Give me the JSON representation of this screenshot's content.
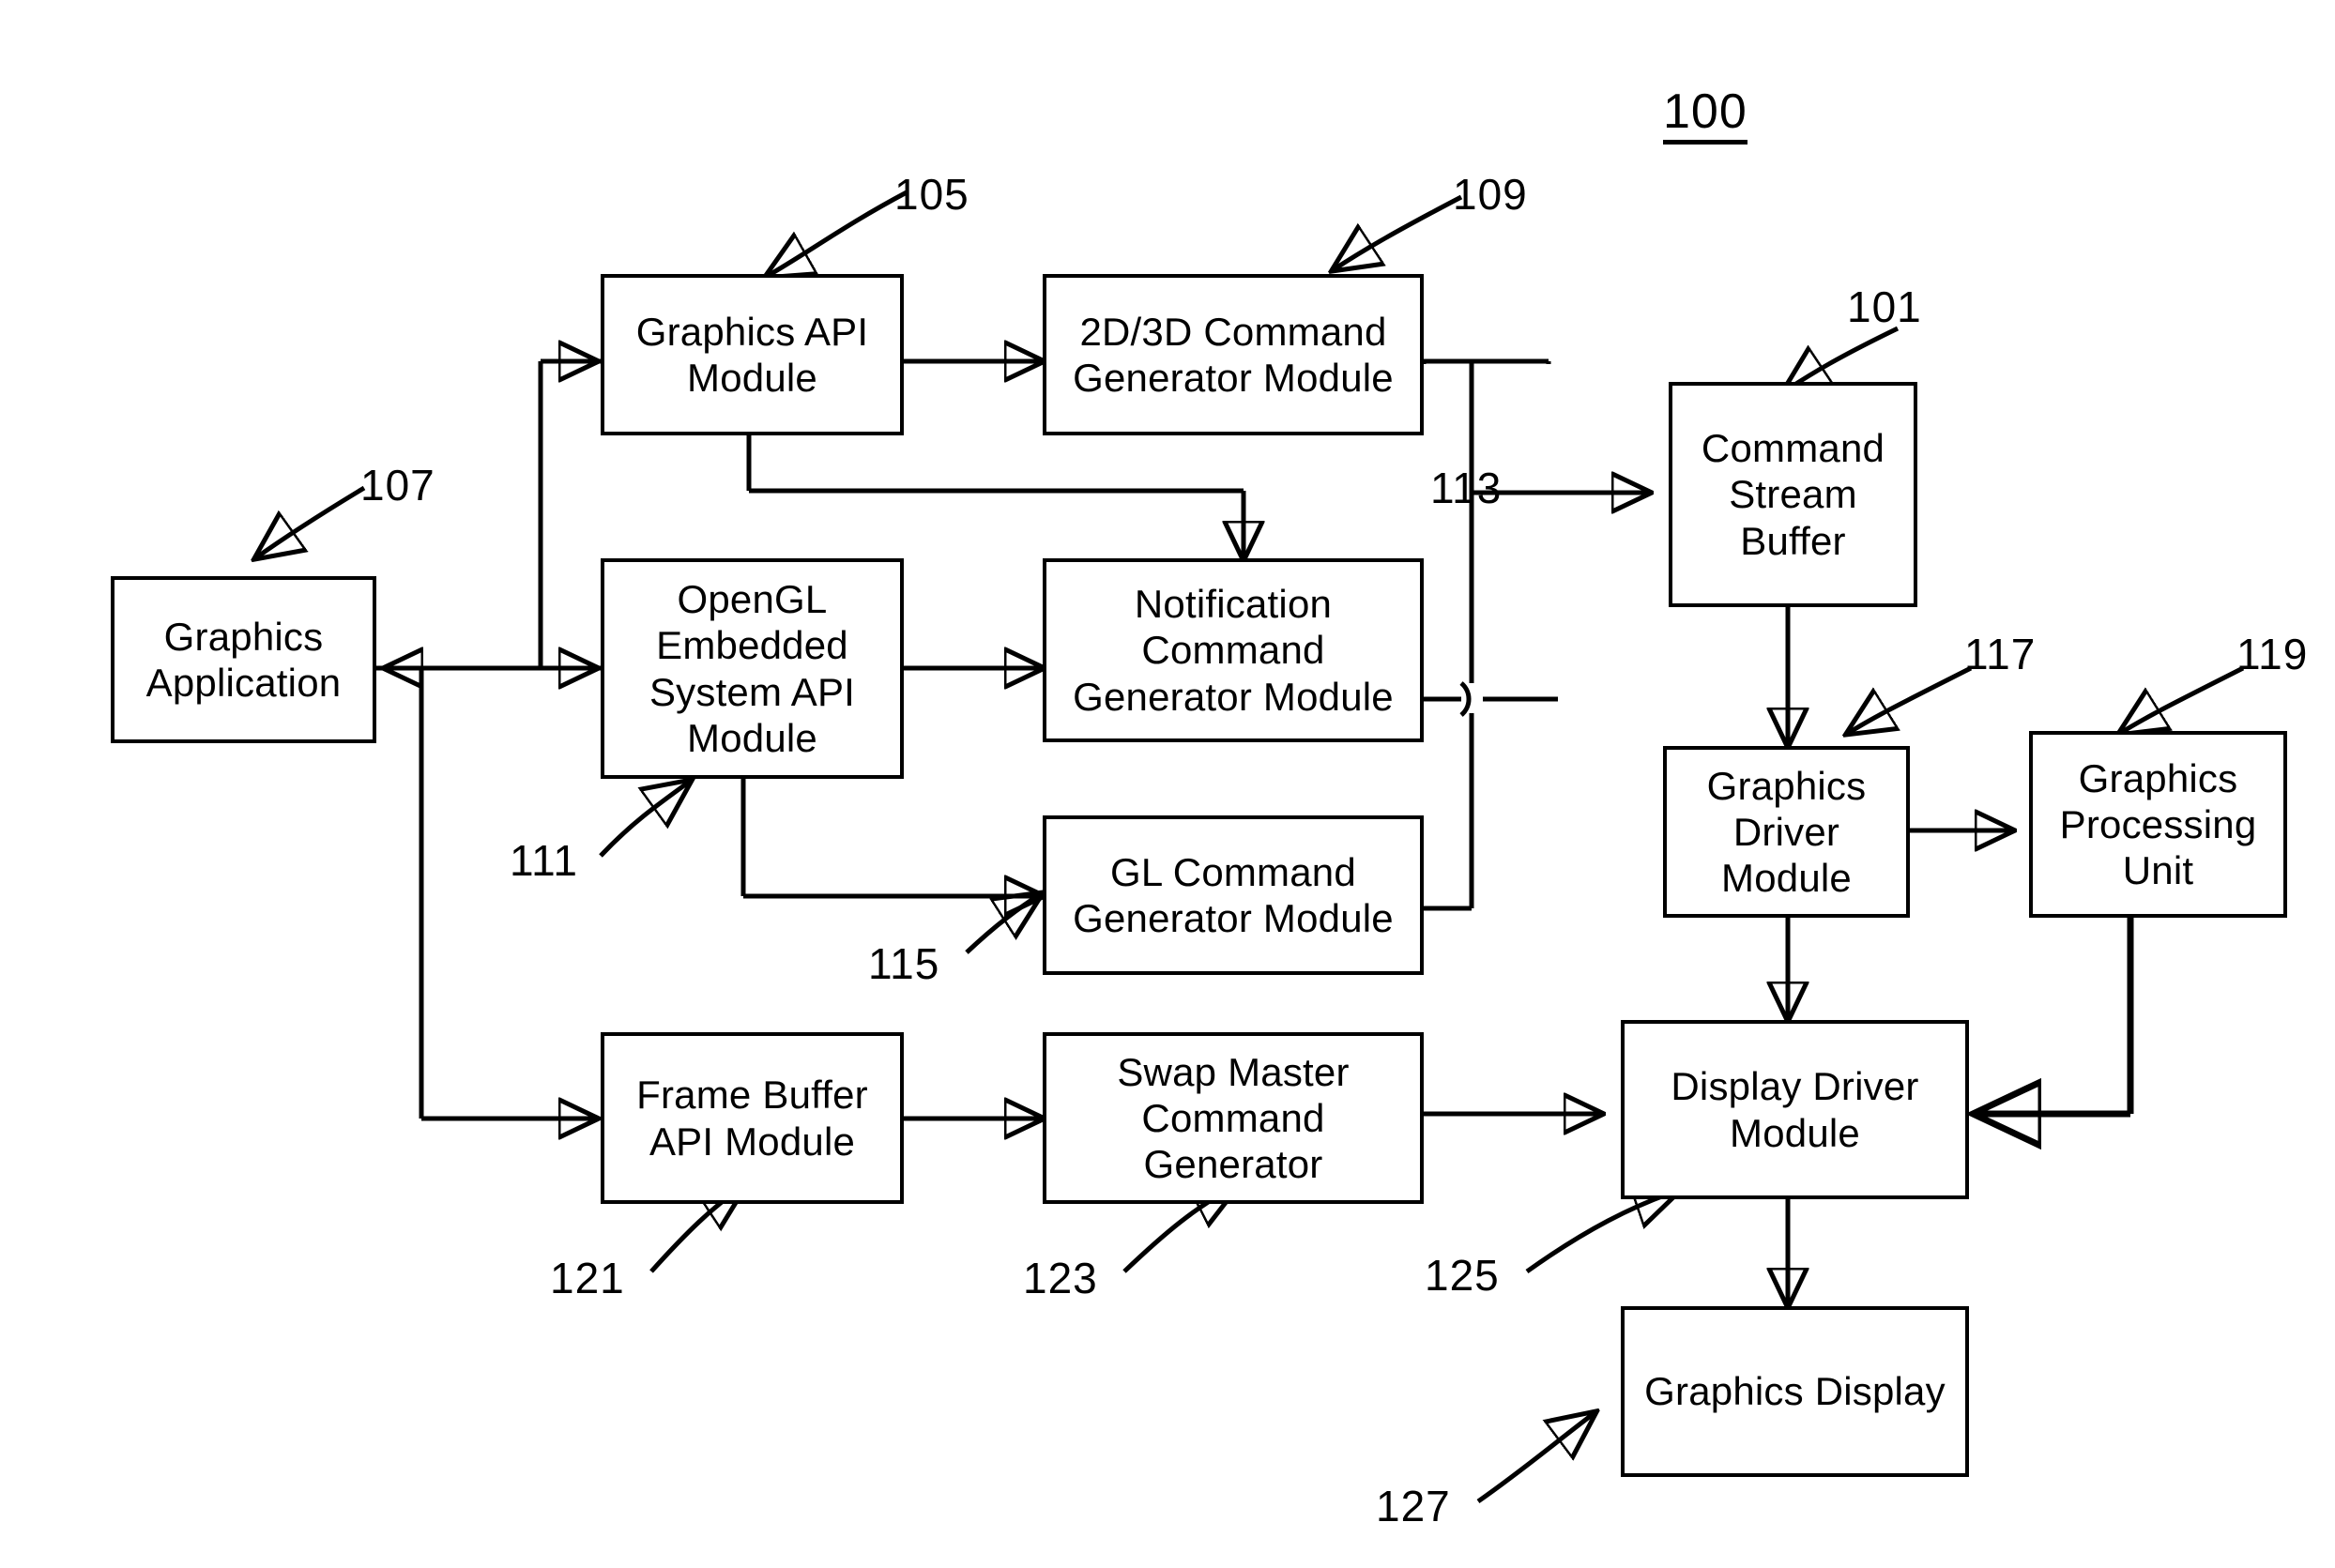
{
  "figure": {
    "number": "100",
    "type": "patent-block-diagram",
    "background": "#ffffff",
    "ink": "#000000"
  },
  "blocks": [
    {
      "id": "graphics_application",
      "label": "Graphics\nApplication",
      "ref": "107"
    },
    {
      "id": "graphics_api_module",
      "label": "Graphics API\nModule",
      "ref": "105"
    },
    {
      "id": "opengl_es_api_module",
      "label": "OpenGL\nEmbedded\nSystem API\nModule",
      "ref": "111"
    },
    {
      "id": "frame_buffer_api_module",
      "label": "Frame Buffer\nAPI Module",
      "ref": "121"
    },
    {
      "id": "cmd_gen_2d3d",
      "label": "2D/3D Command\nGenerator Module",
      "ref": "109"
    },
    {
      "id": "notification_cmd_gen",
      "label": "Notification\nCommand\nGenerator Module",
      "ref": "113"
    },
    {
      "id": "gl_cmd_gen",
      "label": "GL Command\nGenerator Module",
      "ref": "115"
    },
    {
      "id": "swap_master_cmd_gen",
      "label": "Swap Master\nCommand\nGenerator",
      "ref": "123"
    },
    {
      "id": "command_stream_buffer",
      "label": "Command\nStream\nBuffer",
      "ref": "101"
    },
    {
      "id": "graphics_driver_module",
      "label": "Graphics\nDriver\nModule",
      "ref": "117"
    },
    {
      "id": "graphics_processing_unit",
      "label": "Graphics\nProcessing\nUnit",
      "ref": "119"
    },
    {
      "id": "display_driver_module",
      "label": "Display Driver\nModule",
      "ref": "125"
    },
    {
      "id": "graphics_display",
      "label": "Graphics Display",
      "ref": "127"
    }
  ],
  "reference_numerals": [
    {
      "id": "ref-101",
      "text": "101",
      "points_to": "command_stream_buffer"
    },
    {
      "id": "ref-105",
      "text": "105",
      "points_to": "graphics_api_module"
    },
    {
      "id": "ref-107",
      "text": "107",
      "points_to": "graphics_application"
    },
    {
      "id": "ref-109",
      "text": "109",
      "points_to": "cmd_gen_2d3d"
    },
    {
      "id": "ref-111",
      "text": "111",
      "points_to": "opengl_es_api_module"
    },
    {
      "id": "ref-113",
      "text": "113",
      "points_to": "command_stream_bus"
    },
    {
      "id": "ref-115",
      "text": "115",
      "points_to": "gl_cmd_gen"
    },
    {
      "id": "ref-117",
      "text": "117",
      "points_to": "graphics_driver_module"
    },
    {
      "id": "ref-119",
      "text": "119",
      "points_to": "graphics_processing_unit"
    },
    {
      "id": "ref-121",
      "text": "121",
      "points_to": "frame_buffer_api_module"
    },
    {
      "id": "ref-123",
      "text": "123",
      "points_to": "swap_master_cmd_gen"
    },
    {
      "id": "ref-125",
      "text": "125",
      "points_to": "display_driver_module"
    },
    {
      "id": "ref-127",
      "text": "127",
      "points_to": "graphics_display"
    }
  ],
  "connections": [
    {
      "from": "graphics_application",
      "to": "graphics_api_module"
    },
    {
      "from": "graphics_application",
      "to": "opengl_es_api_module"
    },
    {
      "from": "graphics_application",
      "to": "frame_buffer_api_module"
    },
    {
      "from": "opengl_es_api_module",
      "to": "graphics_application"
    },
    {
      "from": "graphics_api_module",
      "to": "cmd_gen_2d3d"
    },
    {
      "from": "graphics_api_module",
      "to": "notification_cmd_gen"
    },
    {
      "from": "opengl_es_api_module",
      "to": "notification_cmd_gen"
    },
    {
      "from": "opengl_es_api_module",
      "to": "gl_cmd_gen"
    },
    {
      "from": "cmd_gen_2d3d",
      "to": "command_stream_buffer"
    },
    {
      "from": "notification_cmd_gen",
      "to": "command_stream_buffer"
    },
    {
      "from": "gl_cmd_gen",
      "to": "command_stream_buffer"
    },
    {
      "from": "command_stream_buffer",
      "to": "graphics_driver_module"
    },
    {
      "from": "graphics_driver_module",
      "to": "graphics_processing_unit"
    },
    {
      "from": "graphics_driver_module",
      "to": "display_driver_module"
    },
    {
      "from": "graphics_processing_unit",
      "to": "display_driver_module"
    },
    {
      "from": "frame_buffer_api_module",
      "to": "swap_master_cmd_gen"
    },
    {
      "from": "swap_master_cmd_gen",
      "to": "display_driver_module"
    },
    {
      "from": "display_driver_module",
      "to": "graphics_display"
    }
  ]
}
